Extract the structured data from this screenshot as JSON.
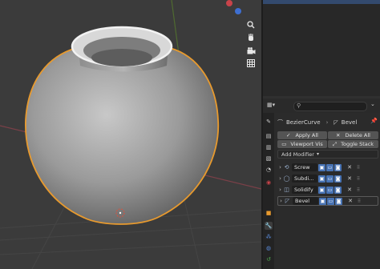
{
  "navigation": {
    "zoom_icon": "magnifier-icon",
    "pan_icon": "hand-icon",
    "camera_icon": "camera-icon",
    "perspective_icon": "grid-icon"
  },
  "properties": {
    "search_placeholder": "",
    "breadcrumb": {
      "object": "BezierCurve",
      "separator": "›",
      "modifier": "Bevel"
    },
    "buttons": {
      "apply_all": "Apply All",
      "delete_all": "Delete All",
      "viewport_vis": "Viewport Vis",
      "toggle_stack": "Toggle Stack"
    },
    "add_modifier": "Add Modifier",
    "modifiers": [
      {
        "name": "Screw"
      },
      {
        "name": "Subdi..."
      },
      {
        "name": "Solidify"
      },
      {
        "name": "Bevel"
      }
    ]
  },
  "colors": {
    "selection_outline": "#e89a2e",
    "accent_blue": "#4772b3"
  }
}
